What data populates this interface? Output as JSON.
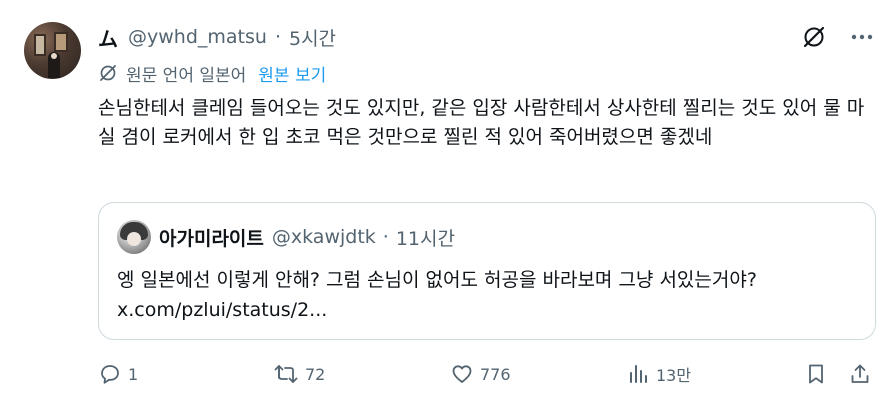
{
  "tweet": {
    "author_handle": "@ywhd_matsu",
    "author_logo": "ム",
    "time": "5시간",
    "separator": "·",
    "translate": {
      "original_language": "원문 언어 일본어",
      "show_original_link": "원본 보기"
    },
    "text": "손님한테서 클레임 들어오는 것도 있지만, 같은 입장 사람한테서 상사한테 찔리는 것도 있어 물 마실 겸이 로커에서 한 입 초코 먹은 것만으로 찔린 적 있어 죽어버렸으면 좋겠네",
    "quote": {
      "name": "아가미라이트",
      "handle": "@xkawjdtk",
      "time": "11시간",
      "separator": "·",
      "text": "엥 일본에선 이렇게 안해? 그럼 손님이 없어도 허공을 바라보며 그냥 서있는거야?\nx.com/pzlui/status/2..."
    },
    "actions": {
      "replies": "1",
      "retweets": "72",
      "likes": "776",
      "views": "13만"
    }
  },
  "icons": {
    "grok": "grok-slash-icon",
    "more": "more-dots-icon",
    "translate": "translate-icon",
    "reply": "reply-icon",
    "retweet": "retweet-icon",
    "like": "heart-icon",
    "views": "views-bars-icon",
    "bookmark": "bookmark-icon",
    "share": "share-icon"
  },
  "colors": {
    "text_primary": "#0f1419",
    "text_secondary": "#536471",
    "link": "#1d9bf0",
    "border": "#cfd9de"
  }
}
